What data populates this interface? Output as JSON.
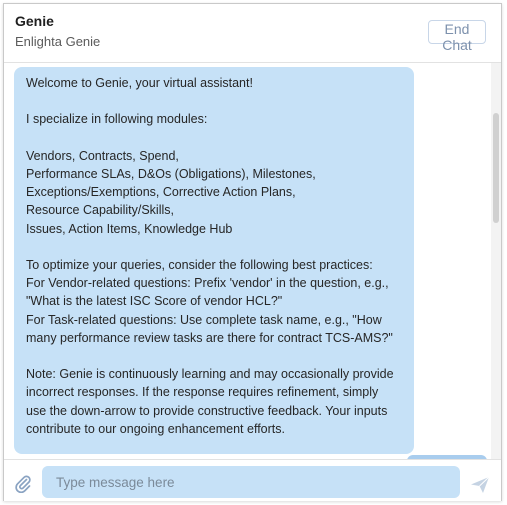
{
  "header": {
    "title": "Genie",
    "subtitle": "Enlighta Genie",
    "end_chat_label": "End Chat"
  },
  "message": {
    "greeting": "Welcome to Genie, your virtual assistant!",
    "modules_intro": "I specialize in following modules:",
    "modules": [
      "Vendors, Contracts, Spend,",
      "Performance SLAs, D&Os (Obligations), Milestones,",
      "Exceptions/Exemptions, Corrective Action Plans,",
      "Resource Capability/Skills,",
      "Issues, Action Items, Knowledge Hub"
    ],
    "practices": [
      "To optimize your queries, consider the following best practices:",
      "For Vendor-related questions: Prefix 'vendor' in the question, e.g.,",
      "\"What is the latest ISC Score of vendor HCL?\"",
      "For Task-related questions: Use complete task name, e.g., \"How",
      "many performance review tasks are there for contract TCS-AMS?\""
    ],
    "note": [
      "Note: Genie is continuously learning and may occasionally provide",
      "incorrect responses. If the response requires refinement, simply",
      "use the down-arrow to provide constructive feedback. Your inputs",
      "contribute to our ongoing enhancement efforts."
    ]
  },
  "composer": {
    "placeholder": "Type message here",
    "attach_icon": "paperclip-icon",
    "send_icon": "send-icon"
  },
  "colors": {
    "bubble": "#c6e1f7",
    "input": "#c6e1f7",
    "icon": "#9fb3cc"
  }
}
